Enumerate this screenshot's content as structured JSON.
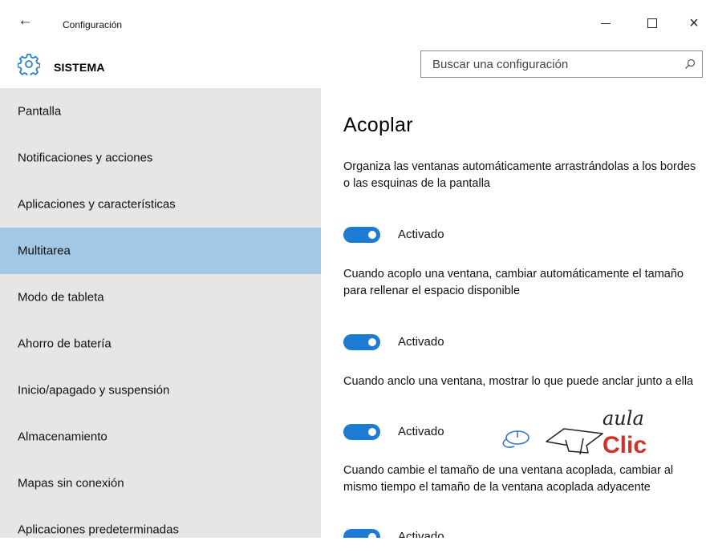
{
  "window": {
    "title": "Configuración",
    "back_glyph": "←",
    "close_glyph": "×"
  },
  "header": {
    "section": "SISTEMA",
    "icon": "gear-icon"
  },
  "search": {
    "placeholder": "Buscar una configuración",
    "value": ""
  },
  "sidebar": {
    "items": [
      {
        "label": "Pantalla",
        "selected": false
      },
      {
        "label": "Notificaciones y acciones",
        "selected": false
      },
      {
        "label": "Aplicaciones y características",
        "selected": false
      },
      {
        "label": "Multitarea",
        "selected": true
      },
      {
        "label": "Modo de tableta",
        "selected": false
      },
      {
        "label": "Ahorro de batería",
        "selected": false
      },
      {
        "label": "Inicio/apagado y suspensión",
        "selected": false
      },
      {
        "label": "Almacenamiento",
        "selected": false
      },
      {
        "label": "Mapas sin conexión",
        "selected": false
      },
      {
        "label": "Aplicaciones predeterminadas",
        "selected": false
      }
    ]
  },
  "main": {
    "heading": "Acoplar",
    "options": [
      {
        "description": "Organiza las ventanas automáticamente arrastrándolas a los bordes o las esquinas de la pantalla",
        "state": "Activado",
        "on": true
      },
      {
        "description": "Cuando acoplo una ventana, cambiar automáticamente el tamaño para rellenar el espacio disponible",
        "state": "Activado",
        "on": true
      },
      {
        "description": "Cuando anclo una ventana, mostrar lo que puede anclar junto a ella",
        "state": "Activado",
        "on": true
      },
      {
        "description": "Cuando cambie el tamaño de una ventana acoplada, cambiar al mismo tiempo el tamaño de la ventana acoplada adyacente",
        "state": "Activado",
        "on": true
      }
    ]
  },
  "watermark": {
    "line1": "aula",
    "line2": "Clic"
  },
  "colors": {
    "accent": "#1e7bd3",
    "sidebar_bg": "#e6e6e6",
    "selected_bg": "#a3c8e6",
    "logo_red": "#d0322a",
    "logo_blue": "#3b74c6"
  }
}
